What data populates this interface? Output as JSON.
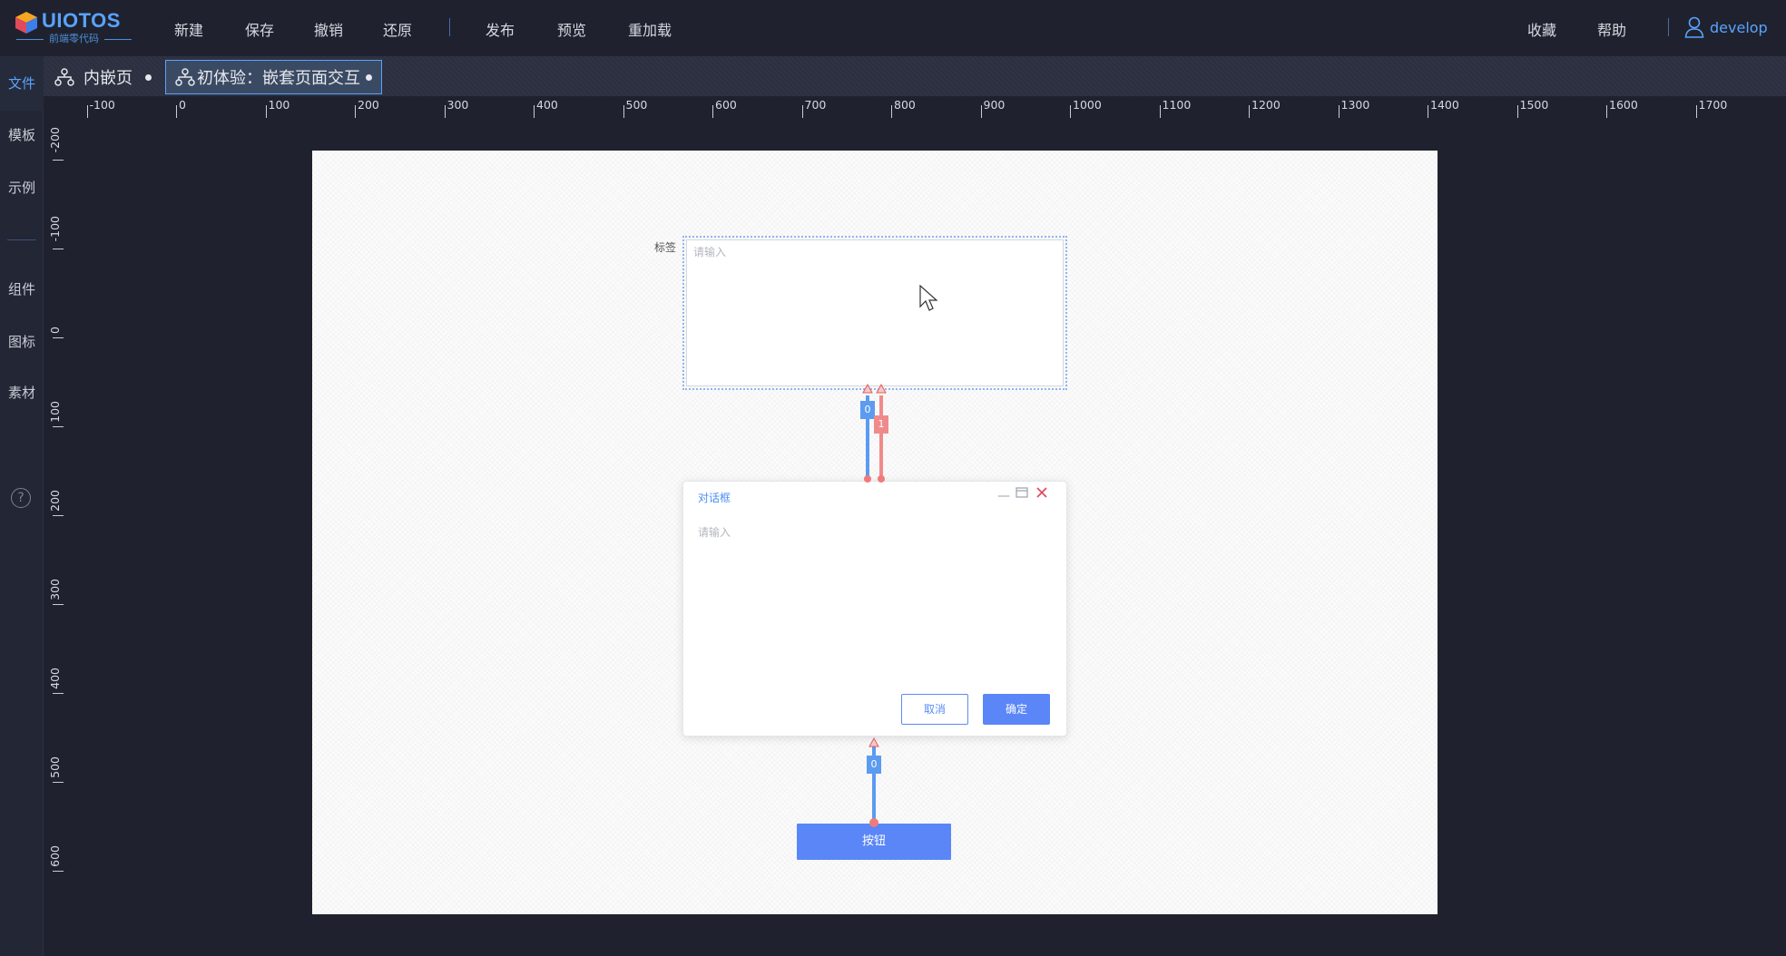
{
  "app": {
    "logo_text": "UIOTOS",
    "logo_sub": "前端零代码",
    "menu": [
      "新建",
      "保存",
      "撤销",
      "还原",
      "发布",
      "预览",
      "重加载"
    ],
    "right_menu": [
      "收藏",
      "帮助"
    ],
    "user": "develop"
  },
  "sidebar": {
    "items": [
      "文件",
      "模板",
      "示例",
      "组件",
      "图标",
      "素材"
    ],
    "help": "?"
  },
  "tabs": [
    {
      "label": "内嵌页"
    },
    {
      "label": "初体验：嵌套页面交互"
    }
  ],
  "ruler": {
    "top_labels": [
      "-100",
      "0",
      "100",
      "200",
      "300",
      "400",
      "500",
      "600",
      "700",
      "800",
      "900",
      "1000",
      "1100",
      "1200",
      "1300",
      "1400",
      "1500",
      "1600",
      "1700"
    ],
    "left_labels": [
      "-200",
      "-100",
      "0",
      "100",
      "200",
      "300",
      "400",
      "500",
      "600"
    ]
  },
  "canvas": {
    "field_label": "标签",
    "textarea_placeholder": "请输入",
    "dialog": {
      "title": "对话框",
      "input_placeholder": "请输入",
      "cancel": "取消",
      "ok": "确定"
    },
    "button": "按钮",
    "links": [
      {
        "label": "0",
        "color": "#5b9bf0"
      },
      {
        "label": "1",
        "color": "#f08a8a"
      },
      {
        "label": "0",
        "color": "#5b9bf0"
      }
    ]
  },
  "colors": {
    "accent": "#5aa3ff",
    "primary_button": "#5a86f7",
    "link_blue": "#5b9bf0",
    "link_red": "#f08a8a"
  }
}
